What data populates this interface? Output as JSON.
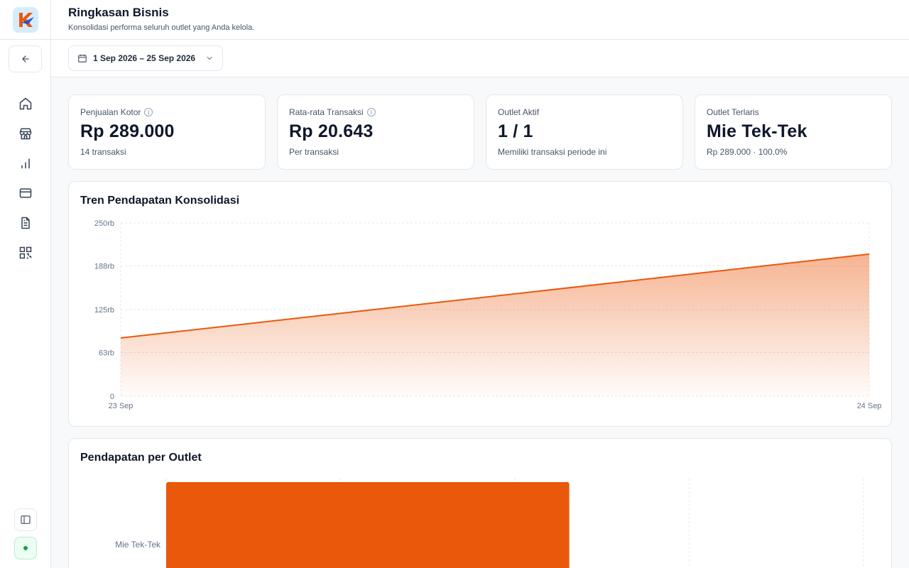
{
  "header": {
    "title": "Ringkasan Bisnis",
    "subtitle": "Konsolidasi performa seluruh outlet yang Anda kelola."
  },
  "date_range": {
    "label": "1 Sep 2026 – 25 Sep 2026"
  },
  "sidebar": {
    "items": [
      {
        "icon": "home-icon"
      },
      {
        "icon": "store-icon"
      },
      {
        "icon": "bar-chart-icon"
      },
      {
        "icon": "credit-card-icon"
      },
      {
        "icon": "document-icon"
      },
      {
        "icon": "qr-code-icon"
      }
    ]
  },
  "kpis": [
    {
      "label": "Penjualan Kotor",
      "value": "Rp 289.000",
      "sub": "14 transaksi"
    },
    {
      "label": "Rata-rata Transaksi",
      "value": "Rp 20.643",
      "sub": "Per transaksi"
    },
    {
      "label": "Outlet Aktif",
      "value": "1 / 1",
      "sub": "Memiliki transaksi periode ini"
    },
    {
      "label": "Outlet Terlaris",
      "value": "Mie Tek-Tek",
      "sub": "Rp 289.000 · 100.0%"
    }
  ],
  "chart_trend": {
    "title": "Tren Pendapatan Konsolidasi"
  },
  "chart_outlet": {
    "title": "Pendapatan per Outlet"
  },
  "colors": {
    "accent": "#ea580c",
    "status": "#16a34a"
  },
  "chart_data": [
    {
      "type": "area",
      "title": "Tren Pendapatan Konsolidasi",
      "x": [
        "23 Sep",
        "24 Sep"
      ],
      "values": [
        84000,
        205000
      ],
      "ylim": [
        0,
        250000
      ],
      "yticks": [
        0,
        63000,
        125000,
        188000,
        250000
      ],
      "ytick_labels": [
        "0",
        "63rb",
        "125rb",
        "188rb",
        "250rb"
      ],
      "grid": true
    },
    {
      "type": "bar",
      "orientation": "horizontal",
      "title": "Pendapatan per Outlet",
      "categories": [
        "Mie Tek-Tek"
      ],
      "values": [
        289000
      ],
      "grid": true
    }
  ]
}
